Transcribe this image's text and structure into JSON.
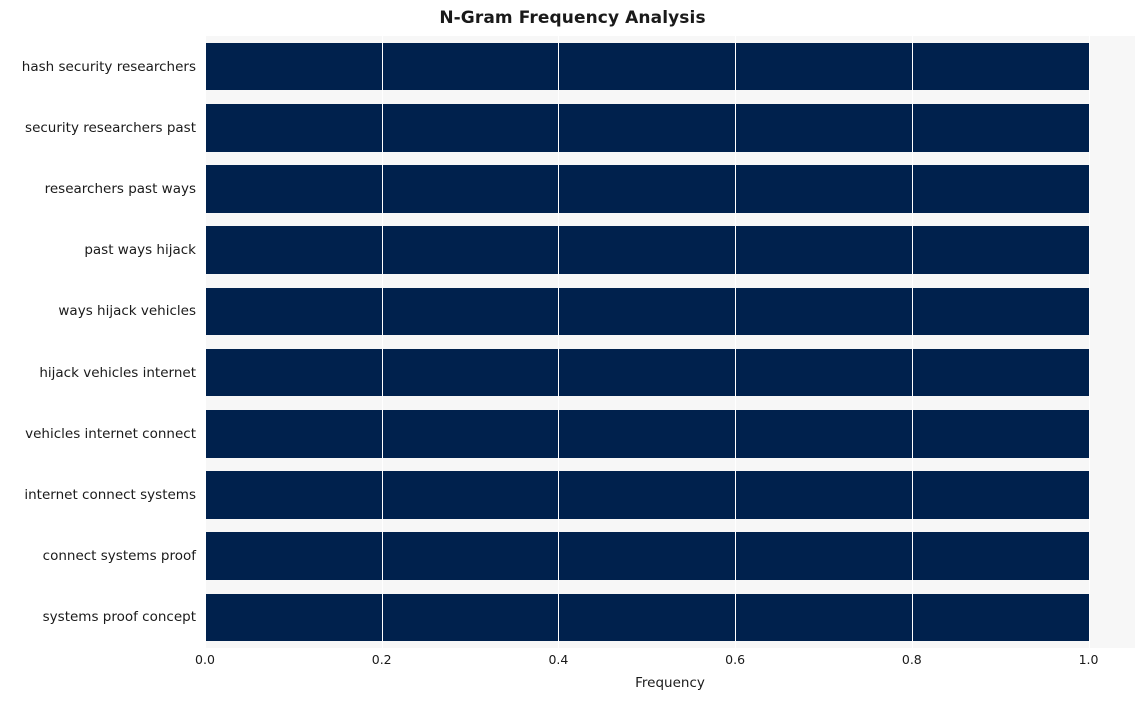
{
  "chart_data": {
    "type": "bar",
    "orientation": "horizontal",
    "title": "N-Gram Frequency Analysis",
    "xlabel": "Frequency",
    "ylabel": "",
    "xlim": [
      0.0,
      1.0526
    ],
    "xticks": [
      0.0,
      0.2,
      0.4,
      0.6,
      0.8,
      1.0
    ],
    "xtick_labels": [
      "0.0",
      "0.2",
      "0.4",
      "0.6",
      "0.8",
      "1.0"
    ],
    "grid": true,
    "grid_axis": "x",
    "legend": null,
    "bar_color": "#00214d",
    "plot_background": "#f7f7f7",
    "categories": [
      "hash security researchers",
      "security researchers past",
      "researchers past ways",
      "past ways hijack",
      "ways hijack vehicles",
      "hijack vehicles internet",
      "vehicles internet connect",
      "internet connect systems",
      "connect systems proof",
      "systems proof concept"
    ],
    "values": [
      1.0,
      1.0,
      1.0,
      1.0,
      1.0,
      1.0,
      1.0,
      1.0,
      1.0,
      1.0
    ]
  }
}
